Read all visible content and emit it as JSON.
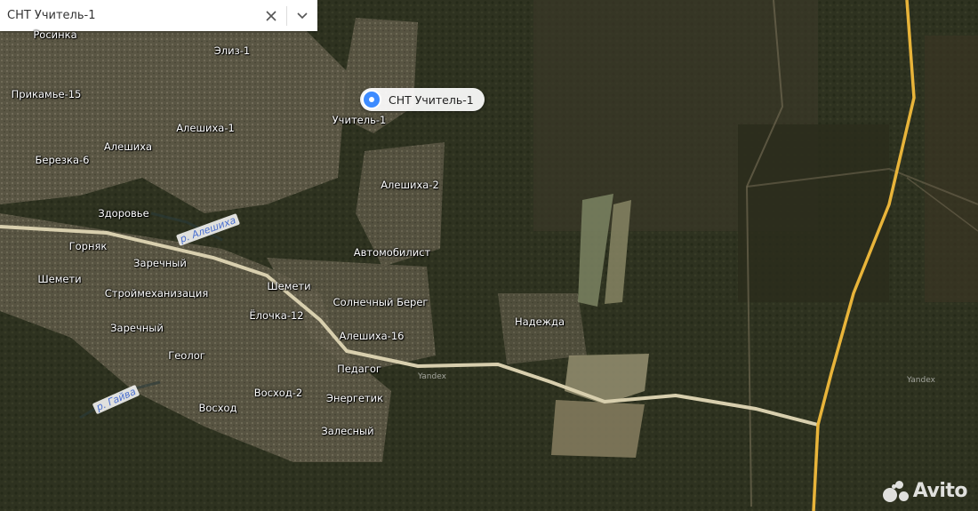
{
  "search": {
    "value": "СНТ Учитель-1",
    "clear_icon": "close-icon",
    "dropdown_icon": "chevron-down-icon"
  },
  "placemark": {
    "label": "СНТ Учитель-1"
  },
  "labels": {
    "rosinka": "Росинка",
    "eliz1": "Элиз-1",
    "prikamye15": "Прикамье-15",
    "uchitel1": "Учитель-1",
    "aleshikha1": "Алешиха-1",
    "aleshikha": "Алешиха",
    "berezka6": "Березка-6",
    "aleshikha2": "Алешиха-2",
    "zdorovye": "Здоровье",
    "gornyak": "Горняк",
    "zarechny1": "Заречный",
    "avtomobilist": "Автомобилист",
    "shemeti1": "Шемети",
    "shemeti2": "Шемети",
    "stroimekhanizatsiya": "Строймеханизация",
    "solnechny_bereg": "Солнечный Берег",
    "elochka12": "Ёлочка-12",
    "zarechny2": "Заречный",
    "nadezhda": "Надежда",
    "aleshikha16": "Алешиха-16",
    "geolog": "Геолог",
    "pedagog": "Педагог",
    "voskhod2": "Восход-2",
    "energetik": "Энергетик",
    "voskhod": "Восход",
    "zalesny": "Залесный"
  },
  "rivers": {
    "aleshikha": "р. Алешиха",
    "gaiva": "р. Гайва"
  },
  "watermarks": {
    "yandex1": "Yandex",
    "yandex2": "Yandex"
  },
  "avito": {
    "text": "Avito"
  },
  "colors": {
    "forest": "#2f3322",
    "settlement": "#6b6552",
    "field": "#8a8164",
    "road": "#d8cfae",
    "highway": "#e8b43a",
    "pin_accent": "#3d8bff"
  }
}
